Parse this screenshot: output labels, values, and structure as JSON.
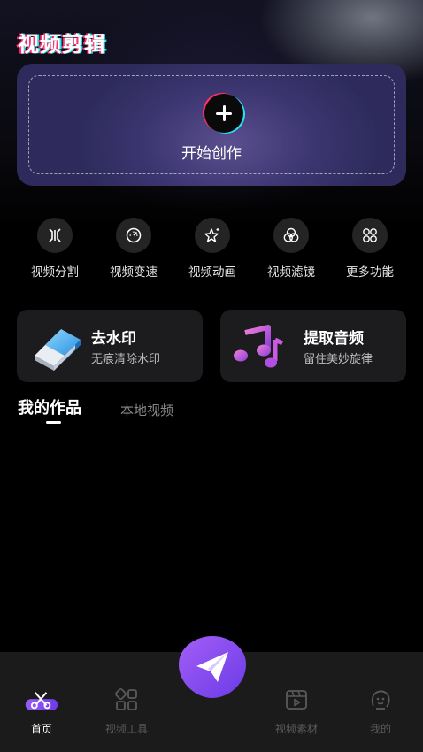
{
  "header": {
    "title": "视频剪辑"
  },
  "create": {
    "label": "开始创作",
    "icon": "plus-icon"
  },
  "tools": [
    {
      "label": "视频分割",
      "icon": "split-icon"
    },
    {
      "label": "视频变速",
      "icon": "speedometer-icon"
    },
    {
      "label": "视频动画",
      "icon": "sparkle-star-icon"
    },
    {
      "label": "视频滤镜",
      "icon": "filter-circles-icon"
    },
    {
      "label": "更多功能",
      "icon": "grid-more-icon"
    }
  ],
  "features": [
    {
      "title": "去水印",
      "subtitle": "无痕清除水印",
      "icon": "eraser-icon"
    },
    {
      "title": "提取音频",
      "subtitle": "留住美妙旋律",
      "icon": "music-notes-icon"
    }
  ],
  "works_tabs": {
    "mine": "我的作品",
    "local": "本地视频",
    "active": "mine"
  },
  "bottom_nav": {
    "items": [
      {
        "label": "首页",
        "icon": "scissors-icon",
        "active": true
      },
      {
        "label": "视频工具",
        "icon": "tools-grid-icon",
        "active": false
      },
      {
        "label": "视频素材",
        "icon": "film-play-icon",
        "active": false
      },
      {
        "label": "我的",
        "icon": "smiley-face-icon",
        "active": false
      }
    ],
    "center_button_icon": "paper-plane-icon"
  },
  "colors": {
    "background": "#000000",
    "accent_purple": "#7b3ff2",
    "accent_pink": "#ff2e6c",
    "accent_cyan": "#25e4f0",
    "card": "#1c1c1e",
    "nav_bg": "#1b1b1b"
  }
}
